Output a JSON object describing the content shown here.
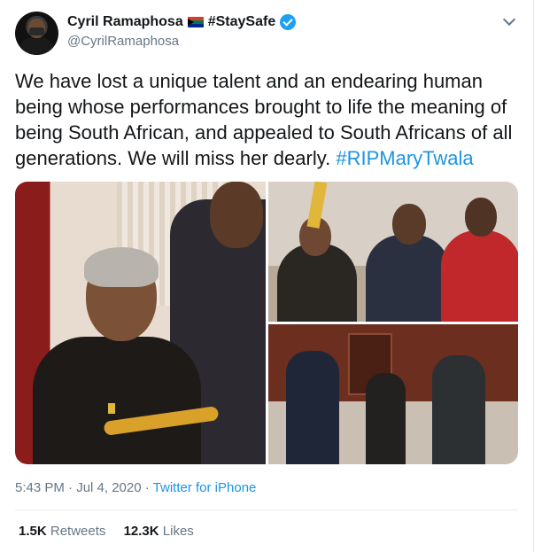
{
  "tweet": {
    "author": {
      "display_name": "Cyril Ramaphosa",
      "badge_text": "#StaySafe",
      "handle": "@CyrilRamaphosa",
      "verified": true
    },
    "text_plain": "We have lost a unique talent and an endearing human being whose performances brought to life the meaning of being South African, and appealed to South Africans of all generations. We will miss her dearly.",
    "hashtag": "#RIPMaryTwala",
    "timestamp": "5:43 PM · Jul 4, 2020",
    "separator": " · ",
    "source": "Twitter for iPhone",
    "stats": {
      "retweets_count": "1.5K",
      "retweets_label": "Retweets",
      "likes_count": "12.3K",
      "likes_label": "Likes"
    }
  },
  "colors": {
    "text": "#14171a",
    "secondary": "#657786",
    "link": "#1b95e0",
    "verified": "#1da1f2"
  },
  "icons": [
    "sa-flag-icon",
    "verified-icon",
    "chevron-down-icon"
  ]
}
